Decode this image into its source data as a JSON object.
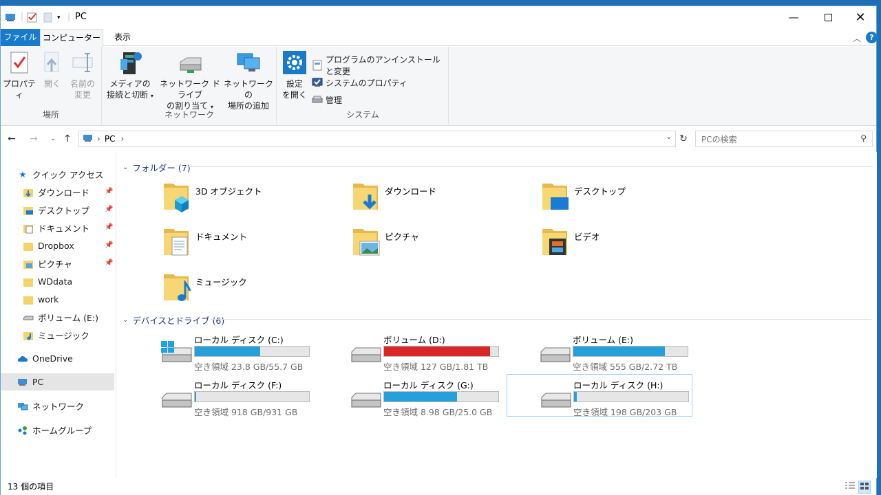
{
  "window": {
    "title": "PC"
  },
  "ribbon_tabs": {
    "file": "ファイル",
    "computer": "コンピューター",
    "view": "表示"
  },
  "ribbon": {
    "location": {
      "label": "場所",
      "properties": "プロパティ",
      "open": "開く",
      "rename_l1": "名前の",
      "rename_l2": "変更"
    },
    "network": {
      "label": "ネットワーク",
      "media_l1": "メディアの",
      "media_l2": "接続と切断",
      "map_l1": "ネットワーク ドライブ",
      "map_l2": "の割り当て",
      "add_l1": "ネットワークの",
      "add_l2": "場所の追加"
    },
    "system": {
      "label": "システム",
      "settings_l1": "設定",
      "settings_l2": "を開く",
      "uninstall": "プログラムのアンインストールと変更",
      "sysprops": "システムのプロパティ",
      "manage": "管理"
    }
  },
  "address": {
    "path": "PC",
    "search_placeholder": "PCの検索"
  },
  "sidebar": {
    "quick_access": "クイック アクセス",
    "items": [
      {
        "label": "ダウンロード"
      },
      {
        "label": "デスクトップ"
      },
      {
        "label": "ドキュメント"
      },
      {
        "label": "Dropbox"
      },
      {
        "label": "ピクチャ"
      },
      {
        "label": "WDdata"
      },
      {
        "label": "work"
      },
      {
        "label": "ボリューム (E:)"
      },
      {
        "label": "ミュージック"
      }
    ],
    "onedrive": "OneDrive",
    "pc": "PC",
    "network": "ネットワーク",
    "homegroup": "ホームグループ"
  },
  "folders": {
    "header": "フォルダー (7)",
    "items": [
      "3D オブジェクト",
      "ダウンロード",
      "デスクトップ",
      "ドキュメント",
      "ピクチャ",
      "ビデオ",
      "ミュージック"
    ]
  },
  "drives": {
    "header": "デバイスとドライブ (6)",
    "items": [
      {
        "name": "ローカル ディスク (C:)",
        "free": "空き領域 23.8 GB/55.7 GB",
        "used": 0.57
      },
      {
        "name": "ボリューム (D:)",
        "free": "空き領域 127 GB/1.81 TB",
        "used": 0.93
      },
      {
        "name": "ボリューム (E:)",
        "free": "空き領域 555 GB/2.72 TB",
        "used": 0.8
      },
      {
        "name": "ローカル ディスク (F:)",
        "free": "空き領域 918 GB/931 GB",
        "used": 0.014
      },
      {
        "name": "ローカル ディスク (G:)",
        "free": "空き領域 8.98 GB/25.0 GB",
        "used": 0.64
      },
      {
        "name": "ローカル ディスク (H:)",
        "free": "空き領域 198 GB/203 GB",
        "used": 0.025
      }
    ]
  },
  "status": {
    "count": "13 個の項目"
  }
}
